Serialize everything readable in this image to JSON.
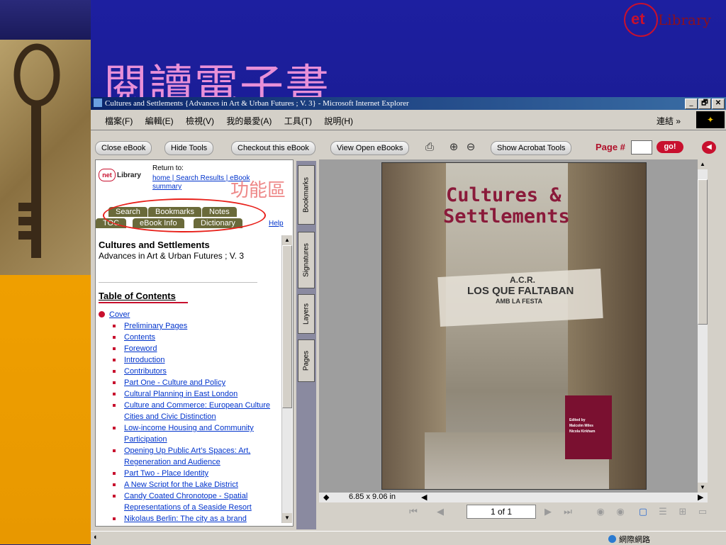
{
  "slide": {
    "title": "閱讀電子書",
    "logo_letters": "et",
    "logo_text": "Library"
  },
  "window": {
    "title": "Cultures and Settlements {Advances in Art & Urban Futures ; V. 3} - Microsoft Internet Explorer",
    "min": "_",
    "max": "🗗",
    "close": "✕",
    "menu": [
      "檔案(F)",
      "編輯(E)",
      "檢視(V)",
      "我的最愛(A)",
      "工具(T)",
      "說明(H)"
    ],
    "links": "連結 »"
  },
  "toolbar": {
    "close_ebook": "Close eBook",
    "hide_tools": "Hide Tools",
    "checkout": "Checkout this eBook",
    "view_open": "View Open eBooks",
    "show_acrobat": "Show Acrobat Tools",
    "page_label": "Page #",
    "go": "go!"
  },
  "panel": {
    "logo": "Library",
    "return_to": "Return to:",
    "return_links": "home | Search Results | eBook summary",
    "annotation": "功能區",
    "tabs_row1": [
      "Search",
      "Bookmarks",
      "Notes"
    ],
    "tabs_row2": [
      "TOC",
      "eBook Info",
      "Dictionary"
    ],
    "help": "Help",
    "book_title": "Cultures and Settlements",
    "book_subtitle": "Advances in Art & Urban Futures ; V. 3",
    "toc_title": "Table of Contents",
    "toc_cover": "Cover",
    "toc_items": [
      "Preliminary Pages",
      "Contents",
      "Foreword",
      "Introduction",
      "Contributors",
      "Part One - Culture and Policy",
      "Cultural Planning in East London",
      "Culture and Commerce: European Culture Cities and Civic Distinction",
      "Low-income Housing and Community Participation",
      "Opening Up Public Art’s Spaces: Art, Regeneration and Audience",
      "Part Two - Place Identity",
      "A New Script for the Lake District",
      "Candy Coated Chronotope - Spatial Representations of a Seaside Resort",
      "Nikolaus Berlin: The city as a brand"
    ]
  },
  "side_tabs": [
    "Bookmarks",
    "Signatures",
    "Layers",
    "Pages"
  ],
  "document": {
    "cover_title_1": "Cultures &",
    "cover_title_2": "Settlements",
    "banner_1": "A.C.R.",
    "banner_2": "LOS QUE FALTABAN",
    "banner_3": "AMB LA FESTA",
    "edited_by": "Edited by",
    "editor_1": "Malcolm Miles",
    "editor_2": "Nicola Kirkham",
    "page_size": "6.85 x 9.06 in",
    "page_of": "1 of 1"
  },
  "status": {
    "network": "網際網路"
  },
  "colors": {
    "accent": "#c8102e",
    "title_pink": "#e890d8",
    "link_blue": "#0033cc"
  }
}
